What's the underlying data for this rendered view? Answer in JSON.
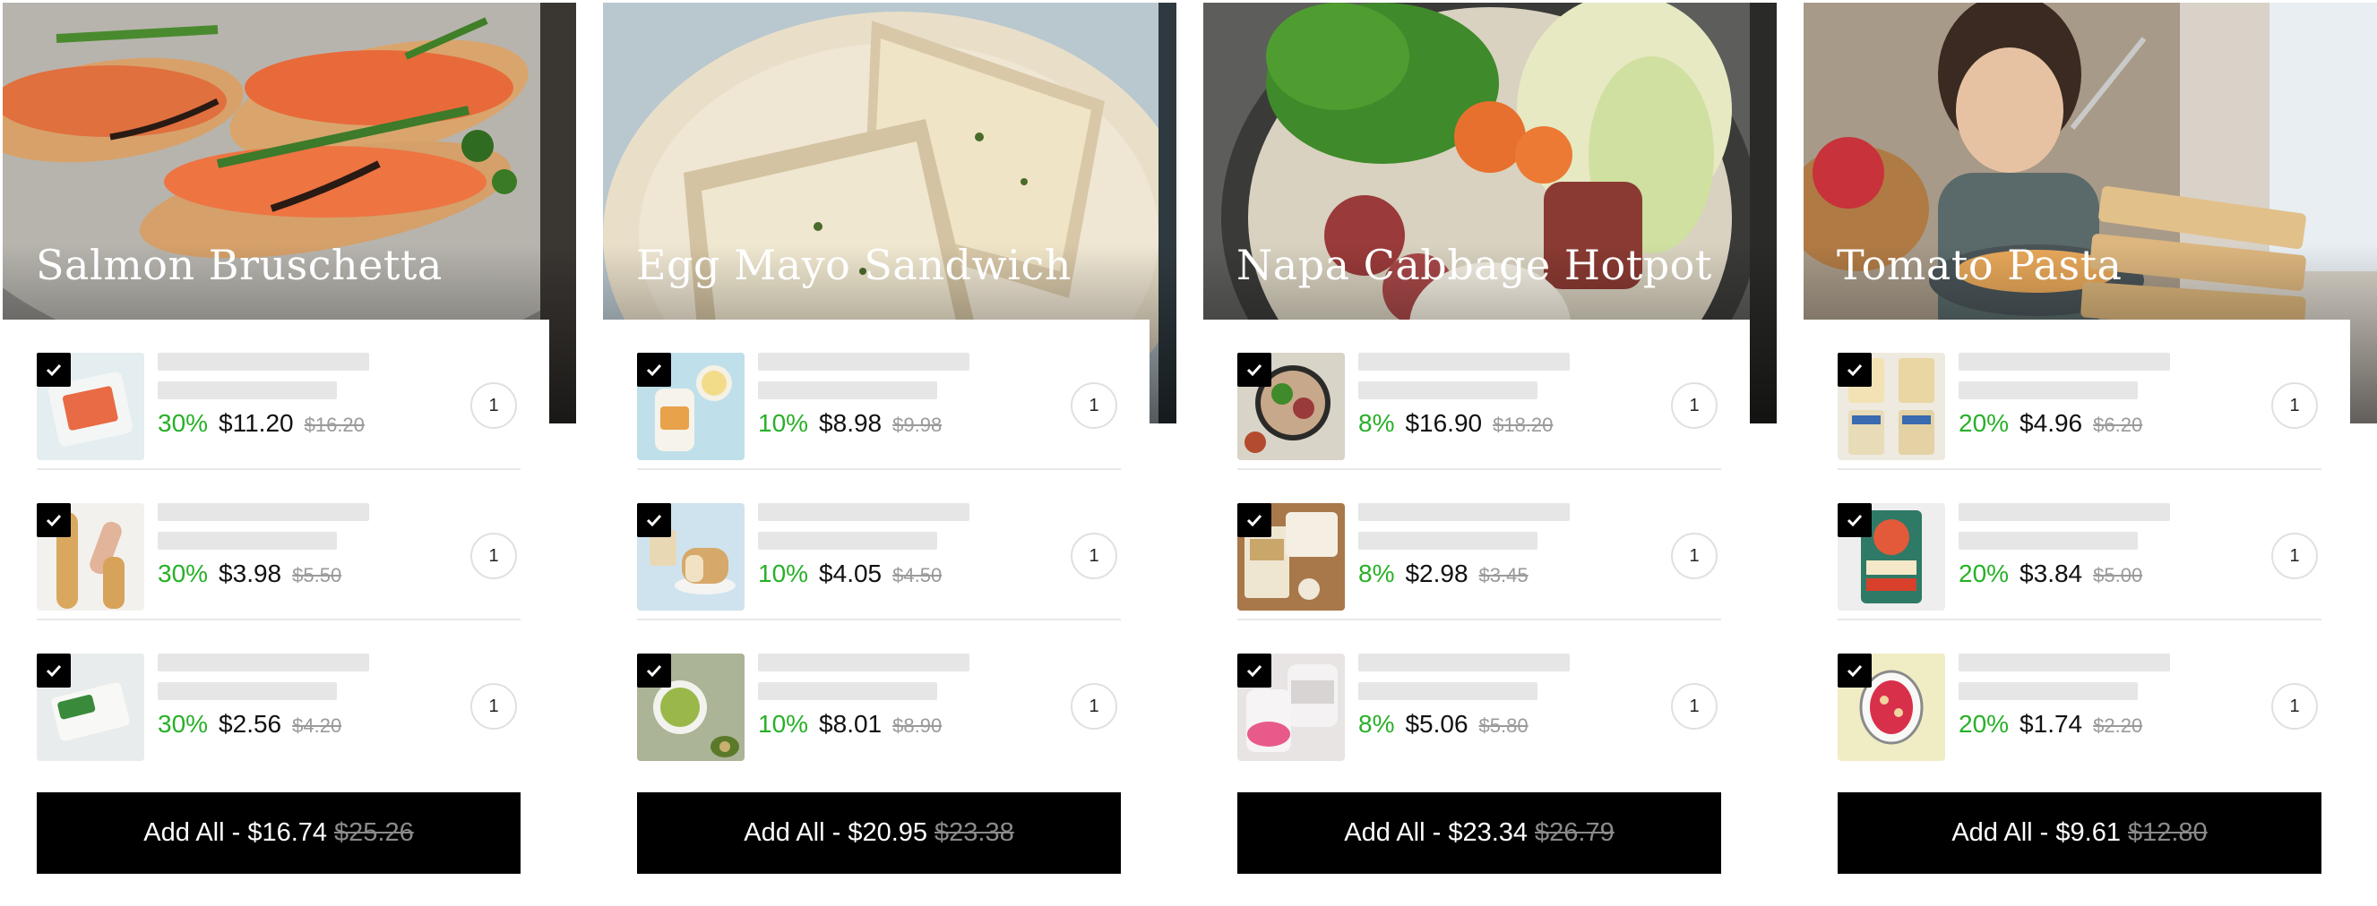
{
  "colors": {
    "discount": "#28b028",
    "button_bg": "#000000",
    "strike": "#9a9a9a"
  },
  "cards": [
    {
      "title": "Salmon Bruschetta",
      "items": [
        {
          "discount": "30%",
          "price": "$11.20",
          "old_price": "$16.20",
          "qty": "1",
          "checked": true
        },
        {
          "discount": "30%",
          "price": "$3.98",
          "old_price": "$5.50",
          "qty": "1",
          "checked": true
        },
        {
          "discount": "30%",
          "price": "$2.56",
          "old_price": "$4.20",
          "qty": "1",
          "checked": true
        }
      ],
      "add_all_label": "Add All - $16.74",
      "add_all_old": "$25.26"
    },
    {
      "title": "Egg Mayo Sandwich",
      "items": [
        {
          "discount": "10%",
          "price": "$8.98",
          "old_price": "$9.98",
          "qty": "1",
          "checked": true
        },
        {
          "discount": "10%",
          "price": "$4.05",
          "old_price": "$4.50",
          "qty": "1",
          "checked": true
        },
        {
          "discount": "10%",
          "price": "$8.01",
          "old_price": "$8.90",
          "qty": "1",
          "checked": true
        }
      ],
      "add_all_label": "Add All - $20.95",
      "add_all_old": "$23.38"
    },
    {
      "title": "Napa Cabbage Hotpot",
      "items": [
        {
          "discount": "8%",
          "price": "$16.90",
          "old_price": "$18.20",
          "qty": "1",
          "checked": true
        },
        {
          "discount": "8%",
          "price": "$2.98",
          "old_price": "$3.45",
          "qty": "1",
          "checked": true
        },
        {
          "discount": "8%",
          "price": "$5.06",
          "old_price": "$5.80",
          "qty": "1",
          "checked": true
        }
      ],
      "add_all_label": "Add All - $23.34",
      "add_all_old": "$26.79"
    },
    {
      "title": "Tomato Pasta",
      "items": [
        {
          "discount": "20%",
          "price": "$4.96",
          "old_price": "$6.20",
          "qty": "1",
          "checked": true
        },
        {
          "discount": "20%",
          "price": "$3.84",
          "old_price": "$5.00",
          "qty": "1",
          "checked": true
        },
        {
          "discount": "20%",
          "price": "$1.74",
          "old_price": "$2.20",
          "qty": "1",
          "checked": true
        }
      ],
      "add_all_label": "Add All - $9.61",
      "add_all_old": "$12.80"
    }
  ]
}
